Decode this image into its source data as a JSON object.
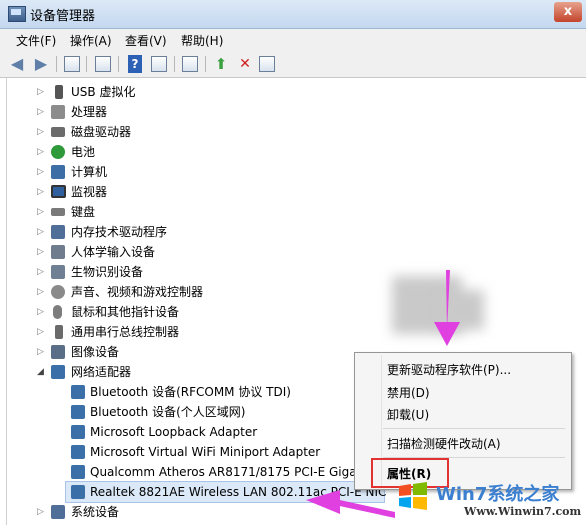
{
  "window": {
    "title": "设备管理器",
    "close_label": "x"
  },
  "menu": [
    "文件(F)",
    "操作(A)",
    "查看(V)",
    "帮助(H)"
  ],
  "toolbar": [
    "back-icon",
    "forward-icon",
    "properties-icon",
    "tree-icon",
    "help-icon",
    "show-icon",
    "scan-icon",
    "update-driver-icon",
    "disable-icon",
    "uninstall-icon"
  ],
  "tree": [
    {
      "label": "USB 虚拟化",
      "level": 1,
      "icon": "usb-icon",
      "color": "#555555"
    },
    {
      "label": "处理器",
      "level": 1,
      "icon": "cpu-icon",
      "color": "#8c8c8c"
    },
    {
      "label": "磁盘驱动器",
      "level": 1,
      "icon": "disk-icon",
      "color": "#6b6b6b"
    },
    {
      "label": "电池",
      "level": 1,
      "icon": "battery-icon",
      "color": "#2e9a3a"
    },
    {
      "label": "计算机",
      "level": 1,
      "icon": "computer-icon",
      "color": "#3d6ea5"
    },
    {
      "label": "监视器",
      "level": 1,
      "icon": "monitor-icon",
      "color": "#2f5f9c"
    },
    {
      "label": "键盘",
      "level": 1,
      "icon": "keyboard-icon",
      "color": "#7a7a7a"
    },
    {
      "label": "内存技术驱动程序",
      "level": 1,
      "icon": "memory-icon",
      "color": "#4f6f98"
    },
    {
      "label": "人体学输入设备",
      "level": 1,
      "icon": "hid-icon",
      "color": "#6e7c8e"
    },
    {
      "label": "生物识别设备",
      "level": 1,
      "icon": "biometric-icon",
      "color": "#6f7f94"
    },
    {
      "label": "声音、视频和游戏控制器",
      "level": 1,
      "icon": "sound-icon",
      "color": "#8a8a8a"
    },
    {
      "label": "鼠标和其他指针设备",
      "level": 1,
      "icon": "mouse-icon",
      "color": "#7d7d7d"
    },
    {
      "label": "通用串行总线控制器",
      "level": 1,
      "icon": "usb-controller-icon",
      "color": "#6a6a6a"
    },
    {
      "label": "图像设备",
      "level": 1,
      "icon": "camera-icon",
      "color": "#5a6e87"
    },
    {
      "label": "网络适配器",
      "level": 1,
      "icon": "network-icon",
      "color": "#3b6fa8",
      "expanded": true
    },
    {
      "label": "Bluetooth 设备(RFCOMM 协议 TDI)",
      "level": 2,
      "icon": "network-adapter-icon",
      "color": "#3b6fa8"
    },
    {
      "label": "Bluetooth 设备(个人区域网)",
      "level": 2,
      "icon": "network-adapter-icon",
      "color": "#3b6fa8"
    },
    {
      "label": "Microsoft Loopback Adapter",
      "level": 2,
      "icon": "network-adapter-icon",
      "color": "#3b6fa8"
    },
    {
      "label": "Microsoft Virtual WiFi Miniport Adapter",
      "level": 2,
      "icon": "network-adapter-icon",
      "color": "#3b6fa8"
    },
    {
      "label": "Qualcomm Atheros AR8171/8175 PCI-E Gigab",
      "level": 2,
      "icon": "network-adapter-icon",
      "color": "#3b6fa8"
    },
    {
      "label": "Realtek 8821AE Wireless LAN 802.11ac PCI-E NIC",
      "level": 2,
      "icon": "network-adapter-icon",
      "color": "#3b6fa8",
      "selected": true
    },
    {
      "label": "系统设备",
      "level": 1,
      "icon": "system-icon",
      "color": "#4f6f98"
    }
  ],
  "context_menu": {
    "items": [
      "更新驱动程序软件(P)...",
      "禁用(D)",
      "卸载(U)",
      "扫描检测硬件改动(A)",
      "属性(R)"
    ],
    "highlight_color": "#e23333"
  },
  "watermark": {
    "brand": "Win7系统之家",
    "url": "Www.Winwin7.com"
  },
  "accent": {
    "arrow": "#e040e0",
    "selection": "#dbe8f7"
  }
}
